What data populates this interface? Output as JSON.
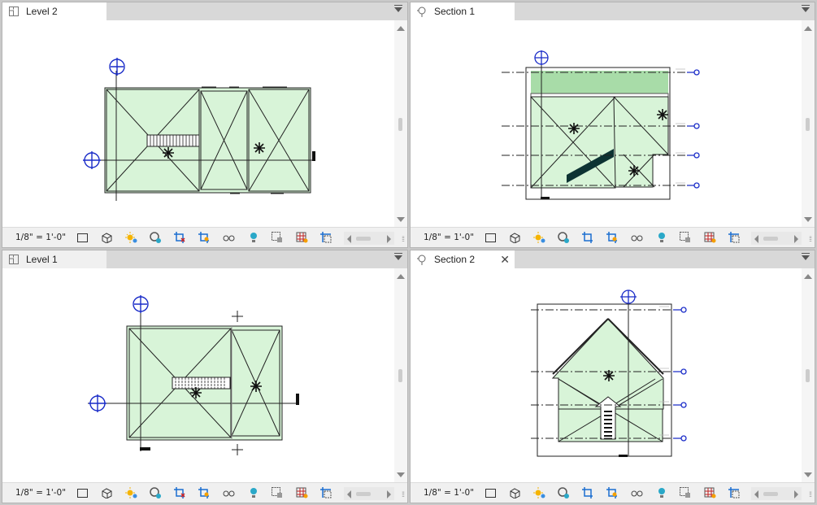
{
  "views": [
    {
      "id": "level2",
      "tab_title": "Level 2",
      "tab_icon": "floor-plan-icon",
      "scale": "1/8\" = 1'-0\"",
      "closable": false
    },
    {
      "id": "section1",
      "tab_title": "Section 1",
      "tab_icon": "section-view-icon",
      "scale": "1/8\" = 1'-0\"",
      "closable": false
    },
    {
      "id": "level1",
      "tab_title": "Level 1",
      "tab_icon": "floor-plan-icon",
      "scale": "1/8\" = 1'-0\"",
      "closable": false
    },
    {
      "id": "section2",
      "tab_title": "Section 2",
      "tab_icon": "section-view-icon",
      "scale": "1/8\" = 1'-0\"",
      "closable": true
    }
  ],
  "view_control_icons": [
    "detail-level-icon",
    "visual-style-icon",
    "sun-path-icon",
    "shadows-icon",
    "crop-view-icon",
    "show-crop-region-icon",
    "unlock-3d-view-icon",
    "temporary-hide-icon",
    "reveal-hidden-icon",
    "worksharing-display-icon",
    "highlight-displacement-icon",
    "analytical-model-icon"
  ],
  "colors": {
    "room_fill": "#d8f4d8",
    "floor_band": "#a8dca8",
    "level_marker": "#1a2cc8",
    "dark_fill": "#0d3333"
  }
}
